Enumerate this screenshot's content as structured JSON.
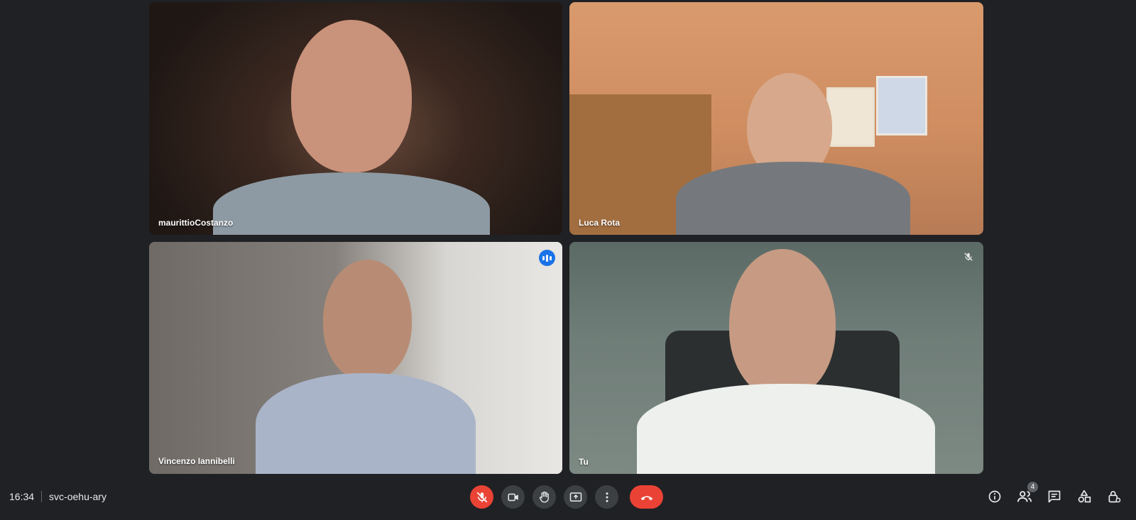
{
  "participants": [
    {
      "name": "maurittioCostanzo"
    },
    {
      "name": "Luca Rota"
    },
    {
      "name": "Vincenzo Iannibelli"
    },
    {
      "name": "Tu"
    }
  ],
  "meeting": {
    "time": "16:34",
    "code": "svc-oehu-ary"
  },
  "people_count": "4",
  "icons": {
    "speaking": "audio-level-icon",
    "self_muted": "mic-off-icon",
    "controls": [
      "mic-off-icon",
      "camera-icon",
      "raise-hand-icon",
      "present-screen-icon",
      "more-options-icon",
      "end-call-icon"
    ],
    "right": [
      "info-icon",
      "people-icon",
      "chat-icon",
      "activities-icon",
      "host-controls-icon"
    ]
  },
  "colors": {
    "background": "#202124",
    "button": "#3c4043",
    "danger": "#ea4335",
    "active_speaker": "#8ab4f8",
    "accent": "#1a73e8"
  }
}
